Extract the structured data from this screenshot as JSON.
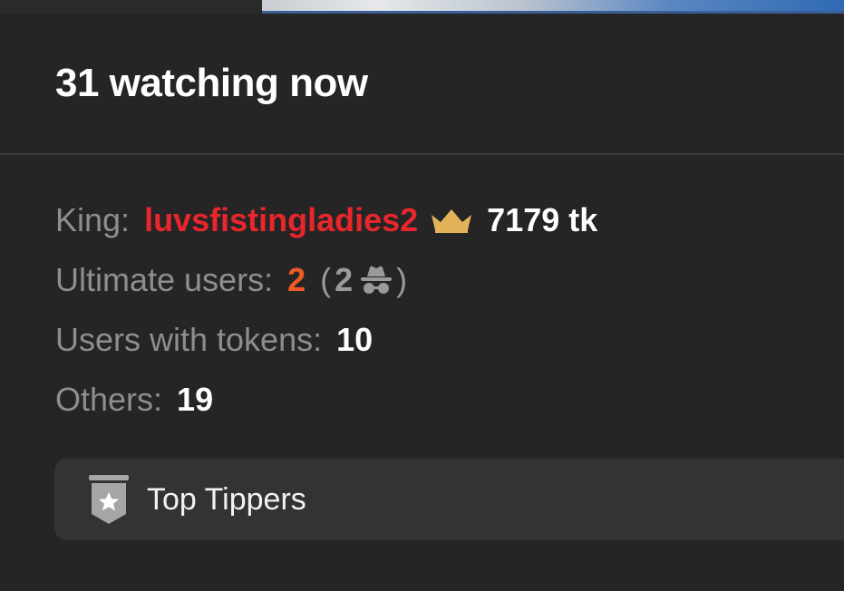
{
  "header": {
    "title": "31 watching now"
  },
  "stats": {
    "king": {
      "label": "King:",
      "username": "luvsfistingladies2",
      "tokens": "7179 tk",
      "icon": "crown-icon",
      "name_color": "#e8262b",
      "crown_color": "#e3b35a"
    },
    "ultimate": {
      "label": "Ultimate users:",
      "count": "2",
      "paren_open": "(",
      "anon_count": "2",
      "paren_close": ")",
      "icon": "incognito-icon",
      "count_color": "#ee5a24"
    },
    "with_tokens": {
      "label": "Users with tokens:",
      "count": "10"
    },
    "others": {
      "label": "Others:",
      "count": "19"
    }
  },
  "top_tippers": {
    "label": "Top Tippers",
    "icon": "star-badge-icon"
  }
}
